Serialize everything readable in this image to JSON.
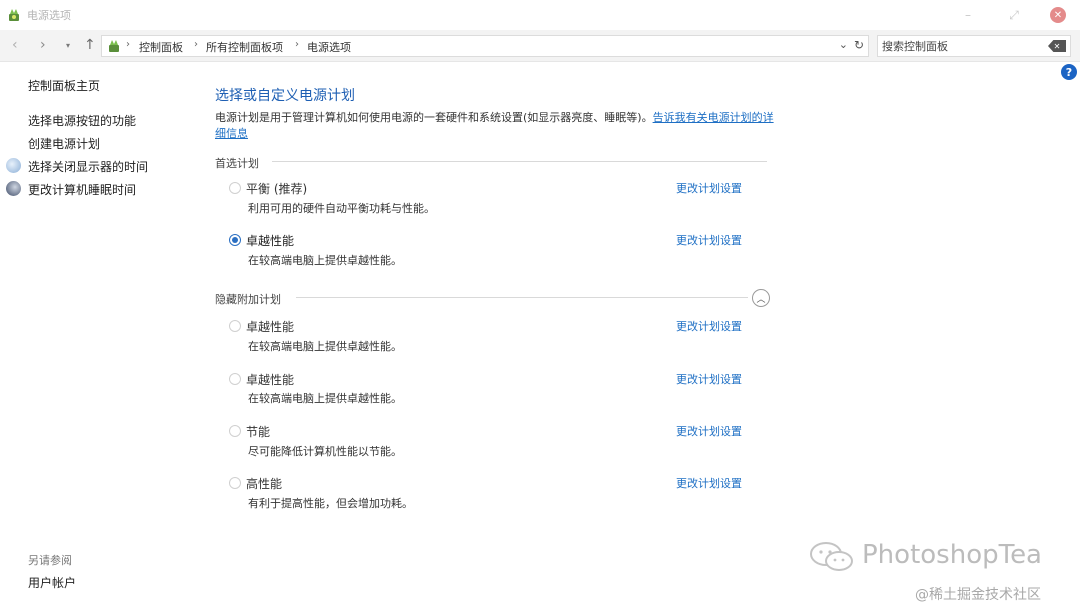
{
  "window": {
    "title": "电源选项",
    "minimize": "–",
    "maximize": "⤢",
    "close": "✕"
  },
  "nav": {
    "back": "‹",
    "forward": "›",
    "recent": "▾",
    "up": "↑",
    "breadcrumb": [
      "控制面板",
      "所有控制面板项",
      "电源选项"
    ],
    "breadcrumb_sep": "›",
    "address_dropdown": "⌄",
    "refresh": "↻",
    "search_placeholder": "搜索控制面板",
    "search_clear": "✕"
  },
  "help": "?",
  "sidebar": {
    "home": "控制面板主页",
    "items": [
      {
        "label": "选择电源按钮的功能",
        "icon": null
      },
      {
        "label": "创建电源计划",
        "icon": null
      },
      {
        "label": "选择关闭显示器的时间",
        "icon": "monitor-icon"
      },
      {
        "label": "更改计算机睡眠时间",
        "icon": "sleep-moon-icon"
      }
    ],
    "see_also_heading": "另请参阅",
    "see_also": [
      "用户帐户"
    ]
  },
  "main": {
    "title": "选择或自定义电源计划",
    "description": "电源计划是用于管理计算机如何使用电源的一套硬件和系统设置(如显示器亮度、睡眠等)。",
    "description_link": "告诉我有关电源计划的详细信息",
    "preferred_heading": "首选计划",
    "hidden_heading": "隐藏附加计划",
    "collapse_symbol": "︿",
    "change_link": "更改计划设置",
    "preferred_plans": [
      {
        "name": "平衡 (推荐)",
        "desc": "利用可用的硬件自动平衡功耗与性能。",
        "selected": false
      },
      {
        "name": "卓越性能",
        "desc": "在较高端电脑上提供卓越性能。",
        "selected": true
      }
    ],
    "hidden_plans": [
      {
        "name": "卓越性能",
        "desc": "在较高端电脑上提供卓越性能。",
        "selected": false
      },
      {
        "name": "卓越性能",
        "desc": "在较高端电脑上提供卓越性能。",
        "selected": false
      },
      {
        "name": "节能",
        "desc": "尽可能降低计算机性能以节能。",
        "selected": false
      },
      {
        "name": "高性能",
        "desc": "有利于提高性能，但会增加功耗。",
        "selected": false
      }
    ]
  },
  "watermark": {
    "brand": "PhotoshopTea",
    "site": "@稀土掘金技术社区"
  },
  "colors": {
    "link": "#1e6fc4",
    "title": "#1e5fb3",
    "radio_checked": "#2b6fc2"
  }
}
